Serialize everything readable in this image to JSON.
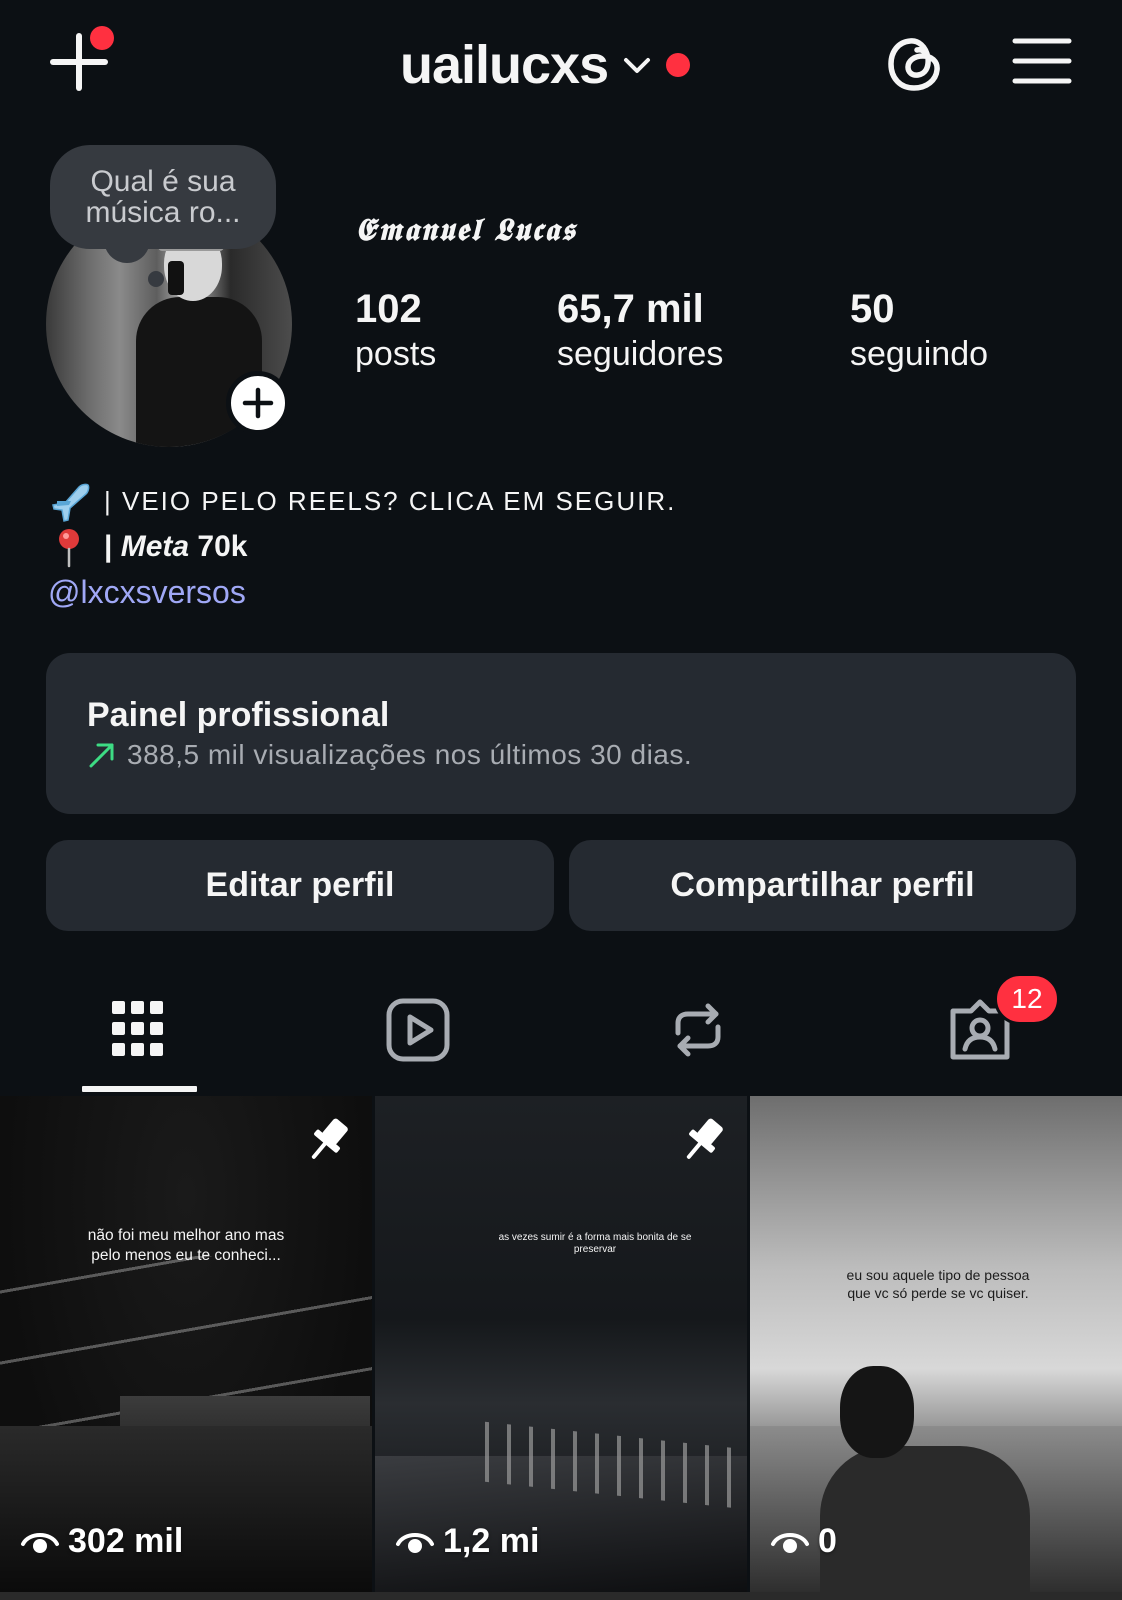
{
  "header": {
    "username": "uailucxs",
    "create_icon": "plus-icon",
    "threads_icon": "threads-icon",
    "menu_icon": "hamburger-menu-icon"
  },
  "profile": {
    "note": "Qual é sua música ro...",
    "display_name": "𝕰𝖒𝖆𝖓𝖚𝖊𝖑 𝕷𝖚𝖈𝖆𝖘",
    "stats": {
      "posts_count": "102",
      "posts_label": "posts",
      "followers_count": "65,7 mil",
      "followers_label": "seguidores",
      "following_count": "50",
      "following_label": "seguindo"
    },
    "bio": {
      "line1": "| VEIO PELO REELS? CLICA EM SEGUIR.",
      "line1_emoji": "airplane",
      "line2_prefix": "| ",
      "line2_meta": "Meta",
      "line2_value": " 70k",
      "line2_emoji": "pushpin",
      "link": "@lxcxsversos"
    }
  },
  "dashboard": {
    "title": "Painel profissional",
    "subtitle": "388,5 mil visualizações nos últimos 30 dias."
  },
  "actions": {
    "edit_label": "Editar perfil",
    "share_label": "Compartilhar perfil"
  },
  "tabs": {
    "grid_icon": "grid-icon",
    "reels_icon": "reels-icon",
    "reposts_icon": "repost-icon",
    "tagged_icon": "tagged-icon",
    "tagged_badge": "12"
  },
  "posts": [
    {
      "caption": "não foi meu melhor ano mas pelo menos eu te conheci...",
      "views": "302 mil",
      "pinned": true
    },
    {
      "caption": "as vezes sumir é a forma mais bonita de se preservar",
      "views": "1,2 mi",
      "pinned": true
    },
    {
      "caption": "eu sou aquele tipo de pessoa que vc só perde se vc quiser.",
      "views": "0",
      "pinned": false
    }
  ],
  "colors": {
    "background": "#0c1014",
    "card": "#252a31",
    "notification": "#ff3040",
    "link": "#a0a8f6",
    "trend_arrow": "#3ddc84"
  }
}
